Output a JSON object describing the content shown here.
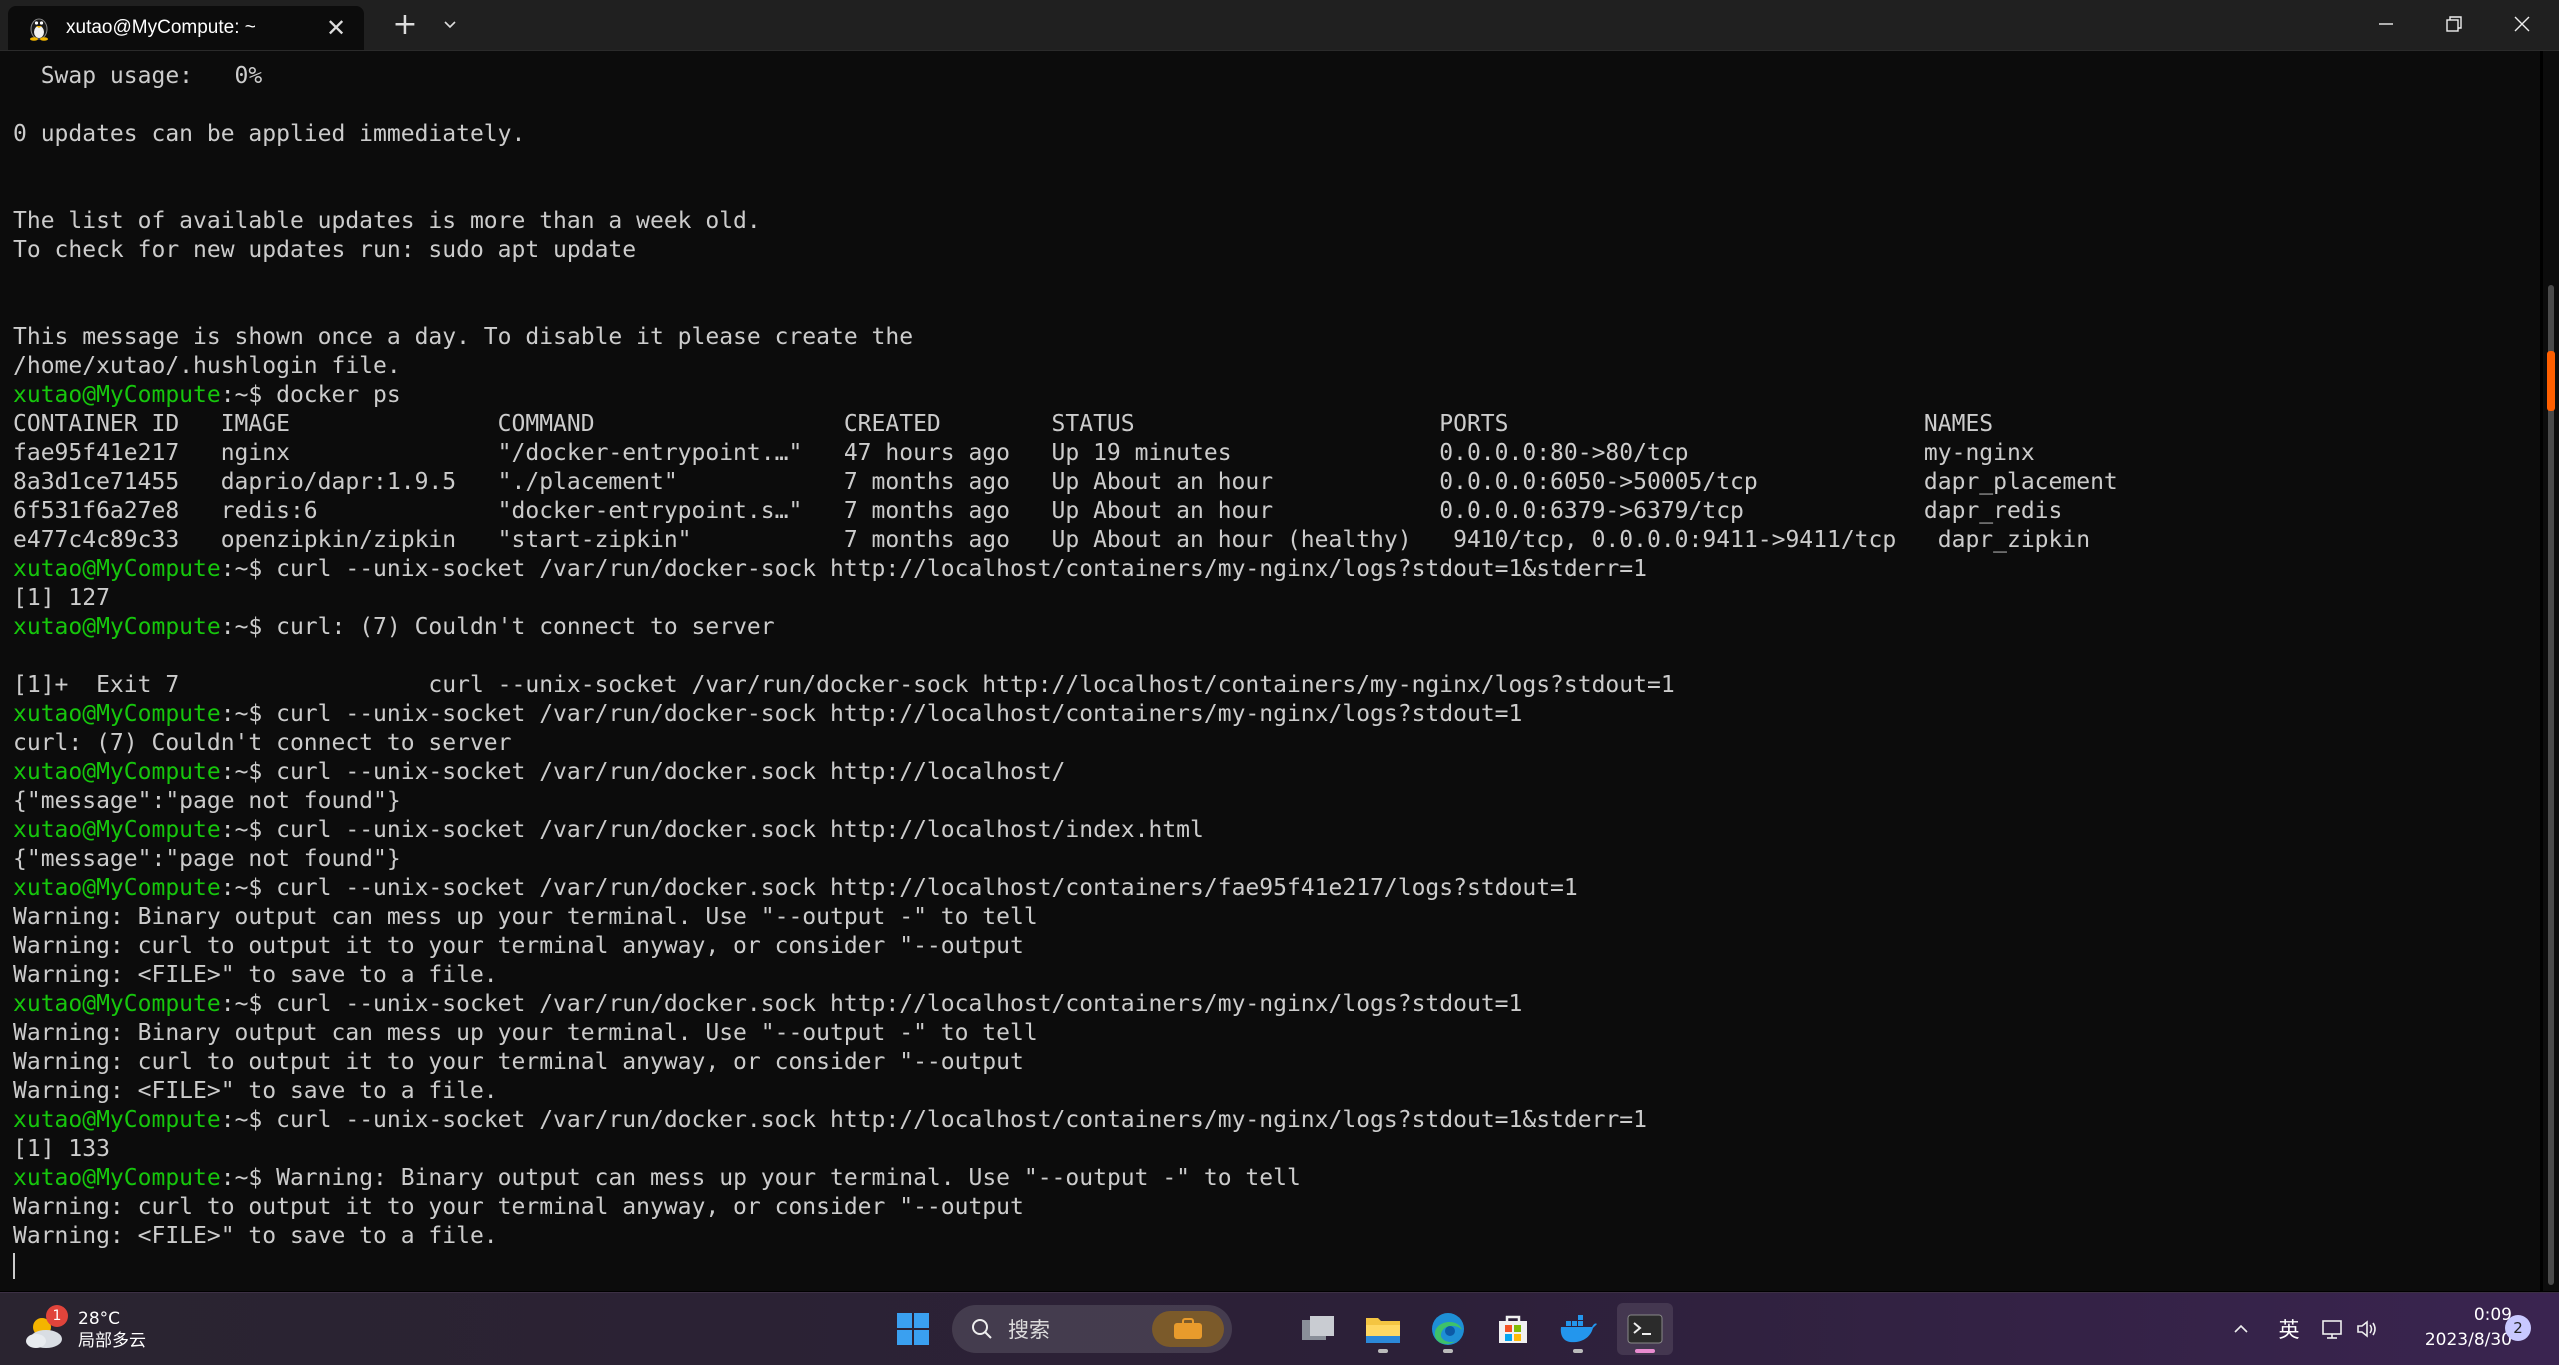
{
  "window": {
    "tab_title": "xutao@MyCompute: ~",
    "tab_icon": "linux-penguin-icon",
    "new_tab_label": "+",
    "dropdown_icon": "chevron-down-icon"
  },
  "terminal": {
    "prompt": "xutao@MyCompute",
    "prompt_suffix": ":~$ ",
    "colors": {
      "background": "#0c0c0c",
      "text": "#cccccc",
      "prompt": "#16c60c"
    },
    "lines": [
      {
        "t": "  Swap usage:   0%"
      },
      {
        "t": ""
      },
      {
        "t": "0 updates can be applied immediately."
      },
      {
        "t": ""
      },
      {
        "t": ""
      },
      {
        "t": "The list of available updates is more than a week old."
      },
      {
        "t": "To check for new updates run: sudo apt update"
      },
      {
        "t": ""
      },
      {
        "t": ""
      },
      {
        "t": "This message is shown once a day. To disable it please create the"
      },
      {
        "t": "/home/xutao/.hushlogin file."
      },
      {
        "p": true,
        "t": "docker ps"
      },
      {
        "t": "CONTAINER ID   IMAGE               COMMAND                  CREATED        STATUS                      PORTS                              NAMES"
      },
      {
        "t": "fae95f41e217   nginx               \"/docker-entrypoint.…\"   47 hours ago   Up 19 minutes               0.0.0.0:80->80/tcp                 my-nginx"
      },
      {
        "t": "8a3d1ce71455   daprio/dapr:1.9.5   \"./placement\"            7 months ago   Up About an hour            0.0.0.0:6050->50005/tcp            dapr_placement"
      },
      {
        "t": "6f531f6a27e8   redis:6             \"docker-entrypoint.s…\"   7 months ago   Up About an hour            0.0.0.0:6379->6379/tcp             dapr_redis"
      },
      {
        "t": "e477c4c89c33   openzipkin/zipkin   \"start-zipkin\"           7 months ago   Up About an hour (healthy)   9410/tcp, 0.0.0.0:9411->9411/tcp   dapr_zipkin"
      },
      {
        "p": true,
        "t": "curl --unix-socket /var/run/docker-sock http://localhost/containers/my-nginx/logs?stdout=1&stderr=1"
      },
      {
        "t": "[1] 127"
      },
      {
        "p": true,
        "t": "curl: (7) Couldn't connect to server"
      },
      {
        "t": ""
      },
      {
        "t": "[1]+  Exit 7                  curl --unix-socket /var/run/docker-sock http://localhost/containers/my-nginx/logs?stdout=1"
      },
      {
        "p": true,
        "t": "curl --unix-socket /var/run/docker-sock http://localhost/containers/my-nginx/logs?stdout=1"
      },
      {
        "t": "curl: (7) Couldn't connect to server"
      },
      {
        "p": true,
        "t": "curl --unix-socket /var/run/docker.sock http://localhost/"
      },
      {
        "t": "{\"message\":\"page not found\"}"
      },
      {
        "p": true,
        "t": "curl --unix-socket /var/run/docker.sock http://localhost/index.html"
      },
      {
        "t": "{\"message\":\"page not found\"}"
      },
      {
        "p": true,
        "t": "curl --unix-socket /var/run/docker.sock http://localhost/containers/fae95f41e217/logs?stdout=1"
      },
      {
        "t": "Warning: Binary output can mess up your terminal. Use \"--output -\" to tell"
      },
      {
        "t": "Warning: curl to output it to your terminal anyway, or consider \"--output"
      },
      {
        "t": "Warning: <FILE>\" to save to a file."
      },
      {
        "p": true,
        "t": "curl --unix-socket /var/run/docker.sock http://localhost/containers/my-nginx/logs?stdout=1"
      },
      {
        "t": "Warning: Binary output can mess up your terminal. Use \"--output -\" to tell"
      },
      {
        "t": "Warning: curl to output it to your terminal anyway, or consider \"--output"
      },
      {
        "t": "Warning: <FILE>\" to save to a file."
      },
      {
        "p": true,
        "t": "curl --unix-socket /var/run/docker.sock http://localhost/containers/my-nginx/logs?stdout=1&stderr=1"
      },
      {
        "t": "[1] 133"
      },
      {
        "p": true,
        "t": "Warning: Binary output can mess up your terminal. Use \"--output -\" to tell"
      },
      {
        "t": "Warning: curl to output it to your terminal anyway, or consider \"--output"
      },
      {
        "t": "Warning: <FILE>\" to save to a file."
      }
    ]
  },
  "taskbar": {
    "weather": {
      "temp": "28°C",
      "desc": "局部多云",
      "badge": "1"
    },
    "search_placeholder": "搜索",
    "apps": [
      "start-icon",
      "task-view-icon",
      "file-explorer-icon",
      "edge-icon",
      "store-icon",
      "docker-icon",
      "terminal-icon"
    ],
    "tray": {
      "chevron": "chevron-up-icon",
      "ime": "英",
      "network": "network-icon",
      "volume": "volume-icon"
    },
    "clock": {
      "time": "0:09",
      "date": "2023/8/30"
    },
    "notification_count": "2"
  }
}
